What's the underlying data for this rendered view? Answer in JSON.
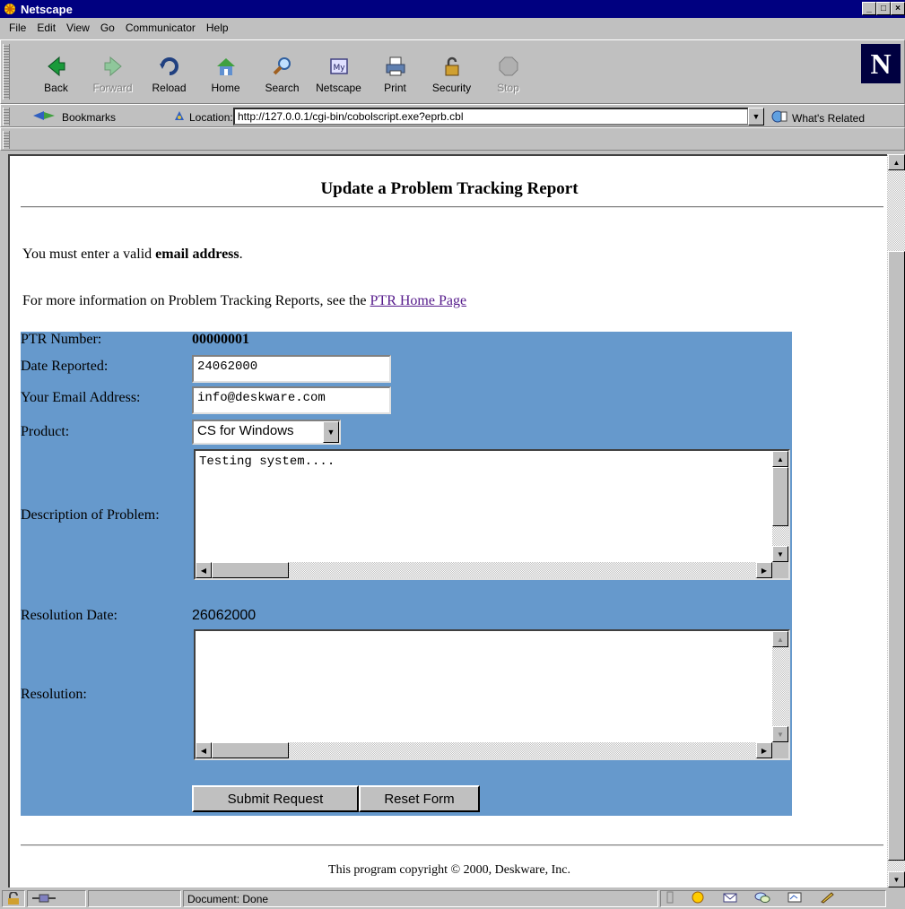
{
  "window": {
    "title": "Netscape"
  },
  "menu": [
    "File",
    "Edit",
    "View",
    "Go",
    "Communicator",
    "Help"
  ],
  "toolbar": {
    "buttons": [
      {
        "label": "Back",
        "icon": "back-arrow-icon",
        "enabled": true
      },
      {
        "label": "Forward",
        "icon": "forward-arrow-icon",
        "enabled": false
      },
      {
        "label": "Reload",
        "icon": "reload-icon",
        "enabled": true
      },
      {
        "label": "Home",
        "icon": "home-icon",
        "enabled": true
      },
      {
        "label": "Search",
        "icon": "search-icon",
        "enabled": true
      },
      {
        "label": "Netscape",
        "icon": "netscape-icon",
        "enabled": true
      },
      {
        "label": "Print",
        "icon": "print-icon",
        "enabled": true
      },
      {
        "label": "Security",
        "icon": "lock-icon",
        "enabled": true
      },
      {
        "label": "Stop",
        "icon": "stop-icon",
        "enabled": false
      }
    ],
    "logo": "N"
  },
  "location_bar": {
    "bookmarks_label": "Bookmarks",
    "location_label": "Location:",
    "url": "http://127.0.0.1/cgi-bin/cobolscript.exe?eprb.cbl",
    "whats_related_label": "What's Related"
  },
  "page": {
    "title": "Update a Problem Tracking Report",
    "message_prefix": "You must enter a valid ",
    "message_bold": "email address",
    "message_suffix": ".",
    "info_prefix": "For more information on Problem Tracking Reports, see the ",
    "info_link": "PTR Home Page",
    "form": {
      "ptr_number_label": "PTR Number:",
      "ptr_number_value": "00000001",
      "date_reported_label": "Date Reported:",
      "date_reported_value": "24062000",
      "email_label": "Your Email Address:",
      "email_value": "info@deskware.com",
      "product_label": "Product:",
      "product_value": "CS for Windows",
      "description_label": "Description of Problem:",
      "description_value": "Testing system....",
      "resolution_date_label": "Resolution Date:",
      "resolution_date_value": "26062000",
      "resolution_label": "Resolution:",
      "resolution_value": "",
      "submit_label": "Submit Request",
      "reset_label": "Reset Form"
    },
    "copyright": "This program copyright © 2000, Deskware, Inc.",
    "panel_color": "#6699cc"
  },
  "status": {
    "text": "Document: Done"
  }
}
